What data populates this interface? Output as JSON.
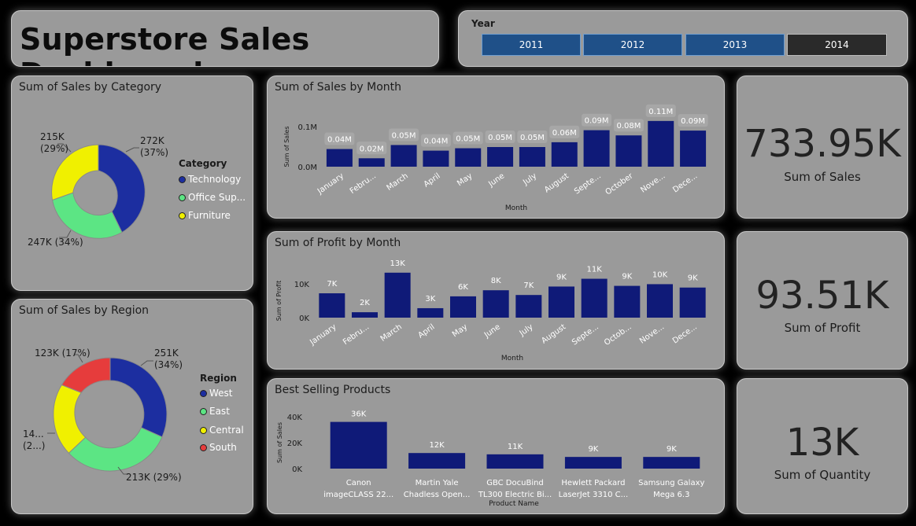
{
  "header": {
    "title": "Superstore Sales Dashboard"
  },
  "year_slicer": {
    "label": "Year",
    "options": [
      {
        "label": "2011",
        "selected": true
      },
      {
        "label": "2012",
        "selected": true
      },
      {
        "label": "2013",
        "selected": true
      },
      {
        "label": "2014",
        "selected": false
      }
    ]
  },
  "colors": {
    "bar": "#0f1a78",
    "technology": "#1c2ea0",
    "office": "#5ce584",
    "furniture": "#f0f000",
    "south": "#e63c3c",
    "slicer_selected": "#1f5088"
  },
  "category_chart": {
    "title": "Sum of Sales by Category",
    "legend_title": "Category",
    "legend": [
      "Technology",
      "Office Sup...",
      "Furniture"
    ],
    "labels": {
      "technology": [
        "272K",
        "(37%)"
      ],
      "office": "247K (34%)",
      "furniture": [
        "215K",
        "(29%)"
      ]
    }
  },
  "region_chart": {
    "title": "Sum of Sales by Region",
    "legend_title": "Region",
    "legend": [
      "West",
      "East",
      "Central",
      "South"
    ],
    "labels": {
      "west": [
        "251K",
        "(34%)"
      ],
      "east": "213K (29%)",
      "central": [
        "14...",
        "(2...)"
      ],
      "south": "123K (17%)"
    }
  },
  "sales_month_chart": {
    "title": "Sum of Sales by Month"
  },
  "profit_month_chart": {
    "title": "Sum of Profit by Month"
  },
  "products_chart": {
    "title": "Best Selling Products"
  },
  "kpis": {
    "sales": {
      "value": "733.95K",
      "label": "Sum of Sales"
    },
    "profit": {
      "value": "93.51K",
      "label": "Sum of Profit"
    },
    "quantity": {
      "value": "13K",
      "label": "Sum of Quantity"
    }
  },
  "chart_data": [
    {
      "id": "category",
      "type": "pie",
      "title": "Sum of Sales by Category",
      "categories": [
        "Technology",
        "Office Supplies",
        "Furniture"
      ],
      "values": [
        272,
        247,
        215
      ],
      "percents": [
        37,
        34,
        29
      ],
      "unit": "K",
      "legend": "right"
    },
    {
      "id": "region",
      "type": "pie",
      "title": "Sum of Sales by Region",
      "categories": [
        "West",
        "East",
        "Central",
        "South"
      ],
      "values": [
        251,
        213,
        147,
        123
      ],
      "percents": [
        34,
        29,
        20,
        17
      ],
      "unit": "K",
      "legend": "right"
    },
    {
      "id": "sales_month",
      "type": "bar",
      "title": "Sum of Sales by Month",
      "xlabel": "Month",
      "ylabel": "Sum of Sales",
      "categories": [
        "January",
        "Febru...",
        "March",
        "April",
        "May",
        "June",
        "July",
        "August",
        "Septe...",
        "October",
        "Nove...",
        "Dece..."
      ],
      "values": [
        0.044,
        0.021,
        0.054,
        0.04,
        0.046,
        0.049,
        0.049,
        0.061,
        0.091,
        0.078,
        0.114,
        0.09
      ],
      "data_labels": [
        "0.04M",
        "0.02M",
        "0.05M",
        "0.04M",
        "0.05M",
        "0.05M",
        "0.05M",
        "0.06M",
        "0.09M",
        "0.08M",
        "0.11M",
        "0.09M"
      ],
      "yticks": [
        "0.0M",
        "0.1M"
      ],
      "ylim": [
        0,
        0.1
      ],
      "grid": false
    },
    {
      "id": "profit_month",
      "type": "bar",
      "title": "Sum of Profit by Month",
      "xlabel": "Month",
      "ylabel": "Sum of Profit",
      "categories": [
        "January",
        "Febru...",
        "March",
        "April",
        "May",
        "June",
        "July",
        "August",
        "Septe...",
        "Octob...",
        "Nove...",
        "Dece..."
      ],
      "values": [
        7.2,
        1.6,
        13.3,
        2.8,
        6.3,
        8.1,
        6.7,
        9.2,
        11.5,
        9.4,
        9.9,
        8.9
      ],
      "data_labels": [
        "7K",
        "2K",
        "13K",
        "3K",
        "6K",
        "8K",
        "7K",
        "9K",
        "11K",
        "9K",
        "10K",
        "9K"
      ],
      "yticks": [
        "0K",
        "10K"
      ],
      "ylim": [
        0,
        10
      ],
      "grid": false
    },
    {
      "id": "products",
      "type": "bar",
      "title": "Best Selling Products",
      "xlabel": "Product Name",
      "ylabel": "Sum of Sales",
      "categories": [
        [
          "Canon",
          "imageCLASS 22..."
        ],
        [
          "Martin Yale",
          "Chadless Open..."
        ],
        [
          "GBC DocuBind",
          "TL300 Electric Bi..."
        ],
        [
          "Hewlett Packard",
          "LaserJet 3310 C..."
        ],
        [
          "Samsung Galaxy",
          "Mega 6.3"
        ]
      ],
      "values": [
        36,
        12,
        11,
        9,
        9
      ],
      "data_labels": [
        "36K",
        "12K",
        "11K",
        "9K",
        "9K"
      ],
      "yticks": [
        "0K",
        "20K",
        "40K"
      ],
      "ylim": [
        0,
        40
      ],
      "grid": false
    }
  ]
}
